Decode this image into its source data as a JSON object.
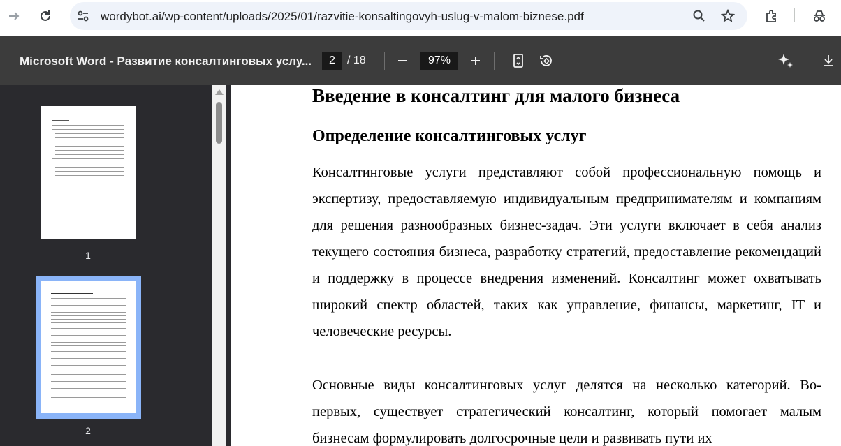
{
  "browser": {
    "url_host": "wordybot.ai",
    "url_path": "/wp-content/uploads/2025/01/razvitie-konsaltingovyh-uslug-v-malom-biznese.pdf"
  },
  "viewer": {
    "title": "Microsoft Word - Развитие консалтинговых услу...",
    "current_page": "2",
    "total_pages": "/ 18",
    "zoom": "97%"
  },
  "sidebar": {
    "thumbnails": [
      {
        "label": "1"
      },
      {
        "label": "2"
      }
    ]
  },
  "document": {
    "heading1": "Введение в консалтинг для малого бизнеса",
    "heading2": "Определение консалтинговых услуг",
    "paragraph1": "Консалтинговые услуги представляют собой профессиональную помощь и экспертизу, предоставляемую индивидуальным предпринимателям и компаниям для решения разнообразных бизнес-задач. Эти услуги включает в себя анализ текущего состояния бизнеса, разработку стратегий, предоставление рекомендаций и поддержку в процессе внедрения изменений. Консалтинг может охватывать широкий спектр областей, таких как управление, финансы, маркетинг, IT и человеческие ресурсы.",
    "paragraph2": "Основные виды консалтинговых услуг делятся на несколько категорий. Во-первых, существует стратегический консалтинг, который помогает малым бизнесам формулировать долгосрочные цели и развивать пути их"
  }
}
